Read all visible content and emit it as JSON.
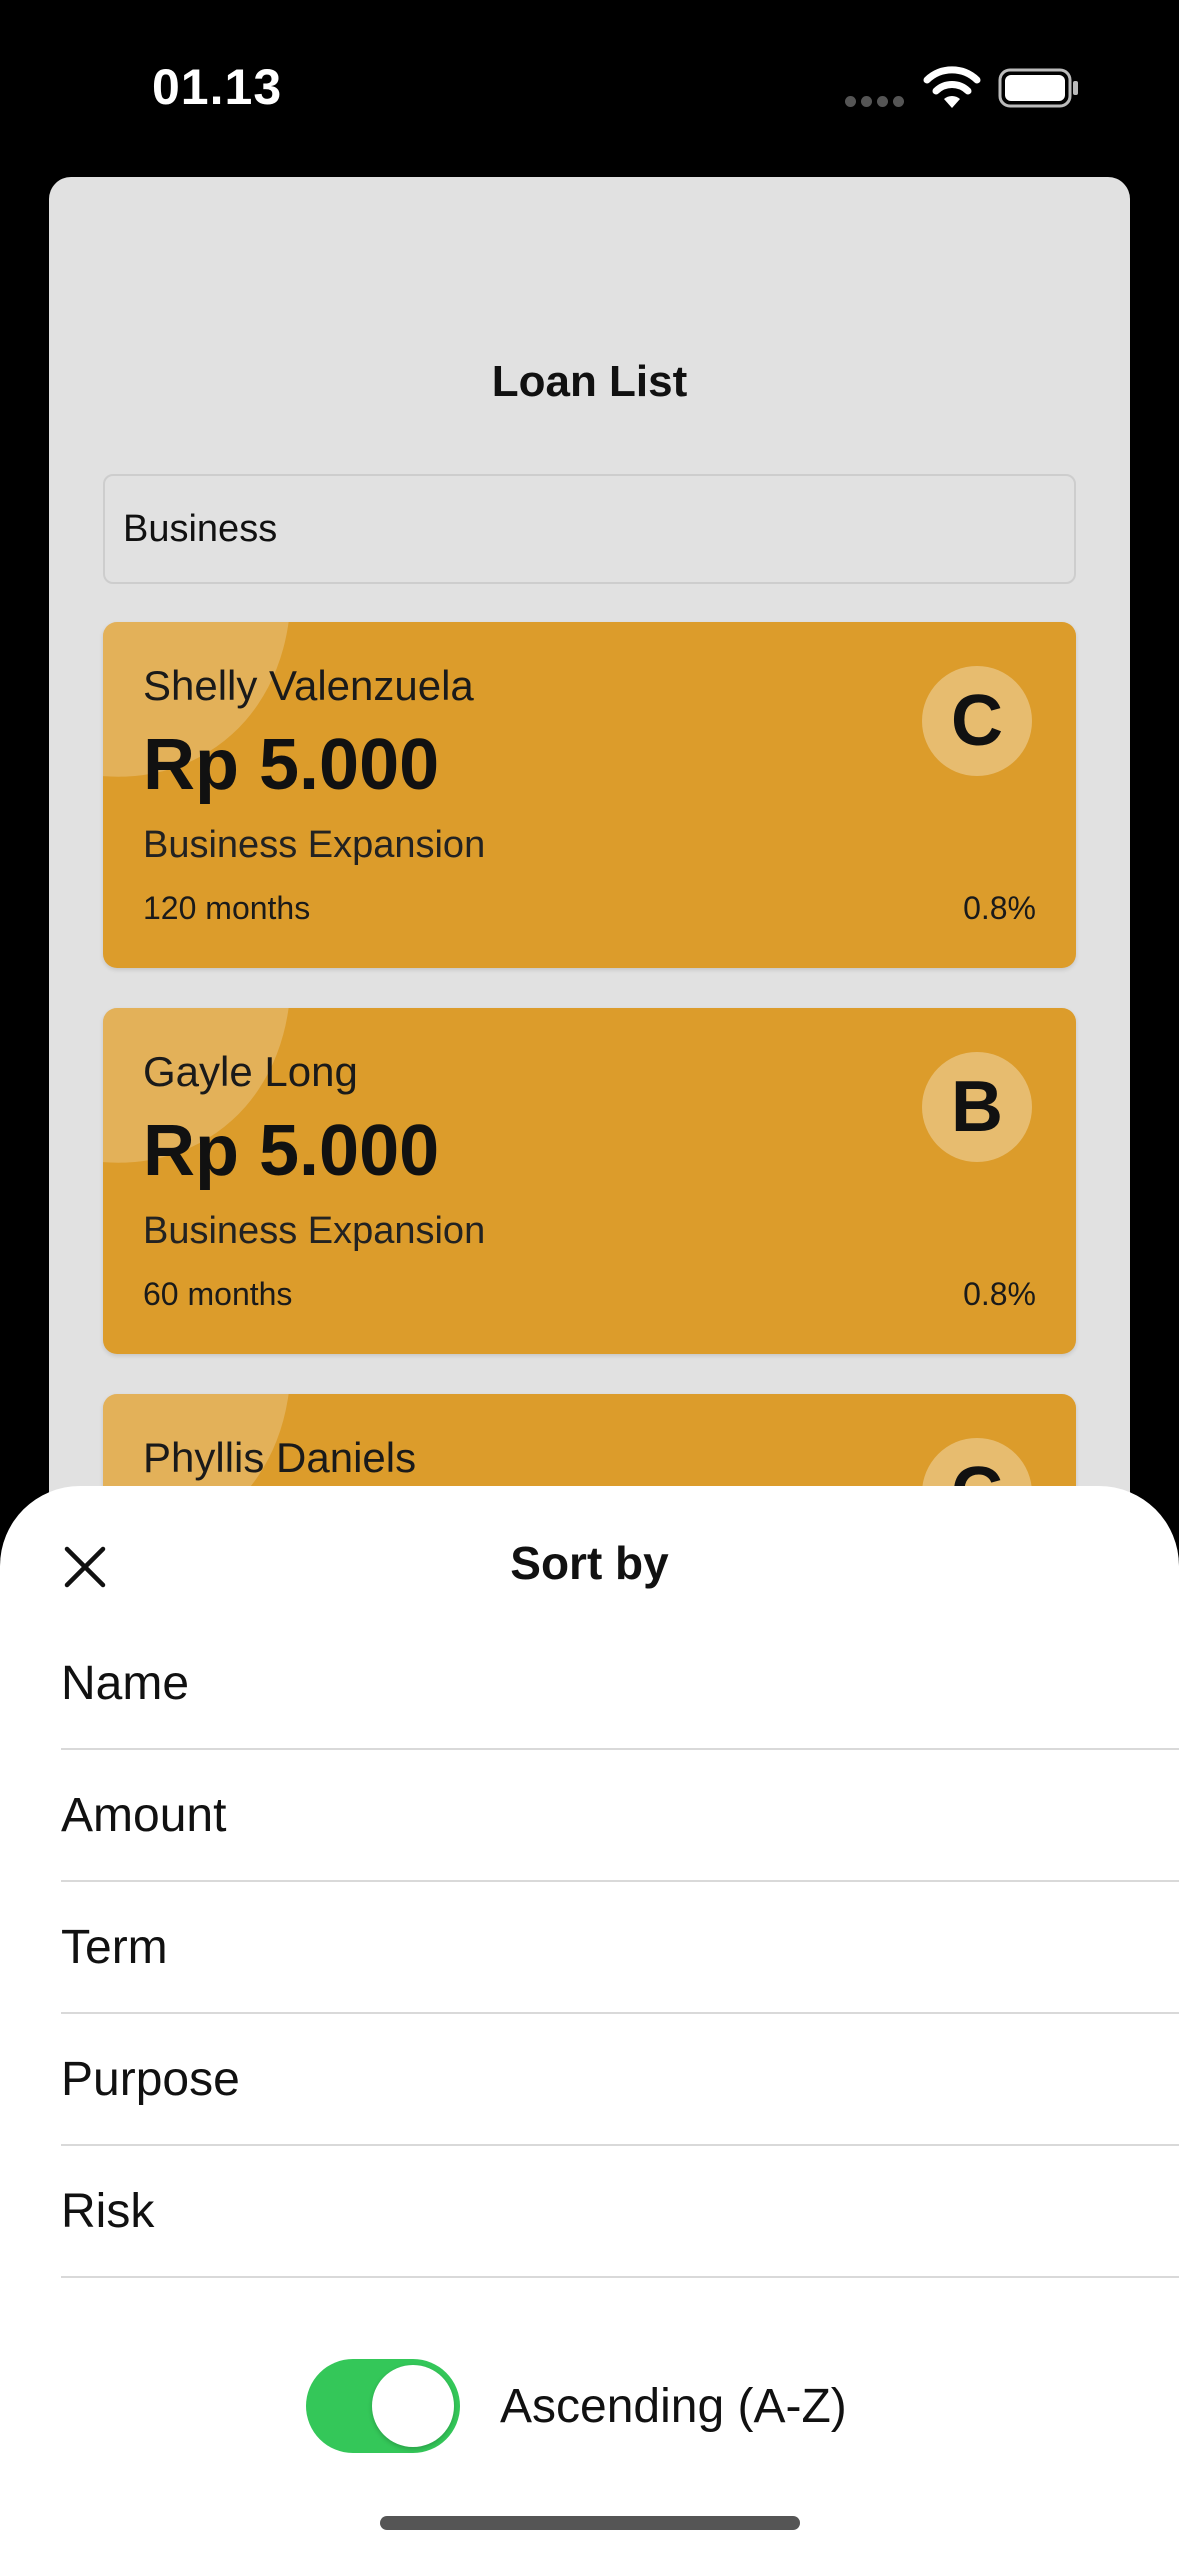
{
  "status_bar": {
    "time": "01.13",
    "icons": [
      "signal-icon",
      "wifi-icon",
      "battery-icon"
    ]
  },
  "loan_list": {
    "title": "Loan List",
    "search": {
      "value": "Business",
      "placeholder": ""
    },
    "cards": [
      {
        "name": "Shelly Valenzuela",
        "amount": "Rp 5.000",
        "purpose": "Business Expansion",
        "term": "120 months",
        "rate": "0.8%",
        "risk": "C"
      },
      {
        "name": "Gayle Long",
        "amount": "Rp 5.000",
        "purpose": "Business Expansion",
        "term": "60 months",
        "rate": "0.8%",
        "risk": "B"
      },
      {
        "name": "Phyllis Daniels",
        "amount": "",
        "purpose": "",
        "term": "",
        "rate": "",
        "risk": "C"
      }
    ]
  },
  "sort_sheet": {
    "title": "Sort by",
    "options": [
      "Name",
      "Amount",
      "Term",
      "Purpose",
      "Risk"
    ],
    "toggle_label": "Ascending (A-Z)",
    "ascending": true
  },
  "colors": {
    "card": "#dc9c2b",
    "toggle_on": "#34c759",
    "sheet_bg": "#e1e1e1"
  }
}
